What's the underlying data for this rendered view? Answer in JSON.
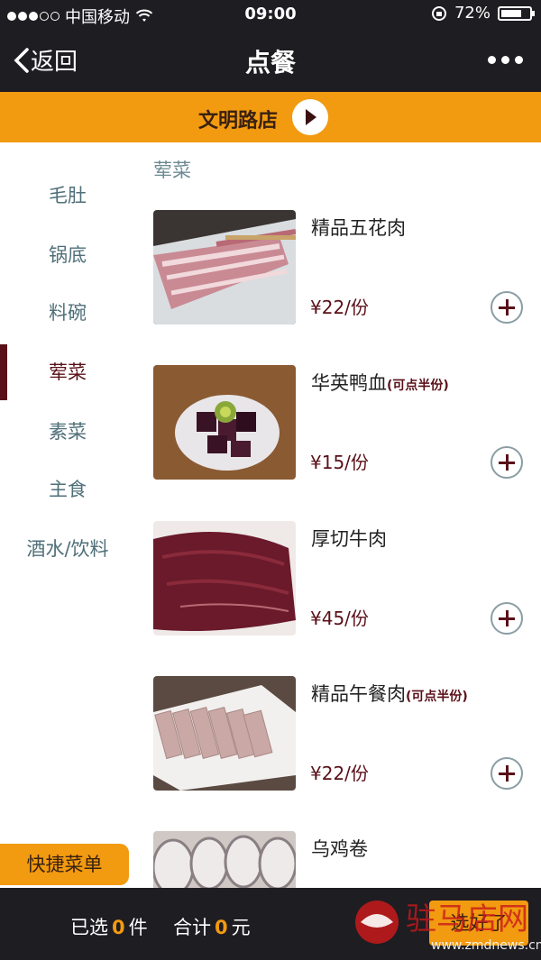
{
  "status": {
    "carrier": "中国移动",
    "time": "09:00",
    "battery": "72%",
    "battery_level": 0.72
  },
  "nav": {
    "back_label": "返回",
    "title": "点餐"
  },
  "store": {
    "name": "文明路店"
  },
  "sidebar": {
    "categories": [
      {
        "label": "毛肚"
      },
      {
        "label": "锅底"
      },
      {
        "label": "料碗"
      },
      {
        "label": "荤菜",
        "active": true
      },
      {
        "label": "素菜"
      },
      {
        "label": "主食"
      },
      {
        "label": "酒水/饮料"
      }
    ]
  },
  "section": {
    "label": "荤菜"
  },
  "items": [
    {
      "name": "精品五花肉",
      "half": "",
      "price": "¥22/份",
      "image": "pork-belly-slices"
    },
    {
      "name": "华英鸭血",
      "half": "(可点半份)",
      "price": "¥15/份",
      "image": "duck-blood-cubes"
    },
    {
      "name": "厚切牛肉",
      "half": "",
      "price": "¥45/份",
      "image": "beef-slices"
    },
    {
      "name": "精品午餐肉",
      "half": "(可点半份)",
      "price": "¥22/份",
      "image": "luncheon-meat"
    },
    {
      "name": "乌鸡卷",
      "half": "",
      "price": "",
      "image": "black-chicken-rolls"
    }
  ],
  "quick_menu": {
    "label": "快捷菜单"
  },
  "cart": {
    "selected_prefix": "已选",
    "selected_count": "0",
    "selected_unit": "件",
    "total_prefix": "合计",
    "total_value": "0",
    "total_unit": "元",
    "done_label": "选好了"
  },
  "watermark": {
    "text": "驻马店网",
    "url": "www.zmdnews.cn"
  },
  "colors": {
    "accent": "#f29a10",
    "dark": "#1e1d22",
    "maroon": "#5a1018",
    "category": "#4f6f78"
  }
}
